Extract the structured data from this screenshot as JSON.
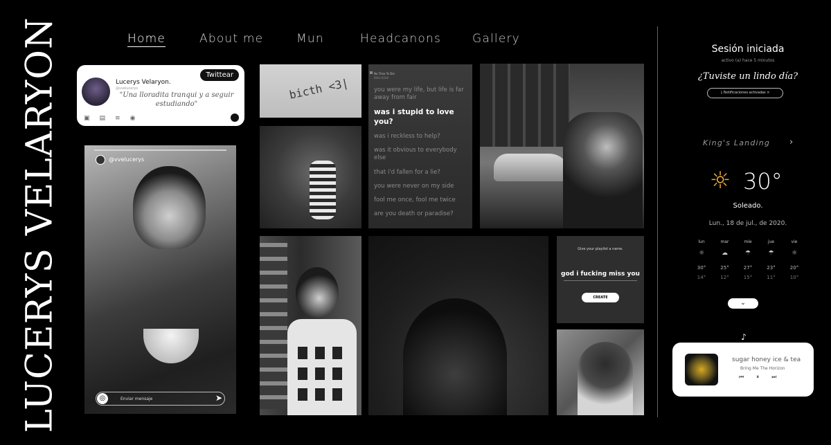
{
  "title": "LUCERYS VELARYON",
  "nav": [
    {
      "label": "Home",
      "active": true
    },
    {
      "label": "About me",
      "active": false
    },
    {
      "label": "Mun",
      "active": false
    },
    {
      "label": "Headcanons",
      "active": false
    },
    {
      "label": "Gallery",
      "active": false
    }
  ],
  "tweet": {
    "name": "Lucerys Velaryon.",
    "handle": "@vvelucerys",
    "text": "\"Una lloradita tranqui y a seguir estudiando\"",
    "button": "Twittear"
  },
  "story": {
    "user": "@vvelucerys",
    "placeholder": "Enviar mensaje"
  },
  "photo_text": "bicth <3|",
  "lyrics": {
    "song": "No Time To Die",
    "artist": "Billie Eilish",
    "lines": [
      {
        "text": "you were my life, but life is far away from fair",
        "highlight": false
      },
      {
        "text": "was i stupid to love you?",
        "highlight": true
      },
      {
        "text": "was i reckless to help?",
        "highlight": false
      },
      {
        "text": "was it obvious to everybody else",
        "highlight": false
      },
      {
        "text": "that i'd fallen for a lie?",
        "highlight": false
      },
      {
        "text": "you were never on my side",
        "highlight": false
      },
      {
        "text": "fool me once, fool me twice",
        "highlight": false
      },
      {
        "text": "are you death or paradise?",
        "highlight": false
      }
    ]
  },
  "playlist": {
    "prompt": "Give your playlist a name.",
    "name": "god i fucking miss you",
    "button": "CREATE"
  },
  "session": {
    "title": "Sesión iniciada",
    "active": "activo (a) hace 5 minutos",
    "question": "¿Tuviste un lindo día?",
    "notif": "Notificaciones activadas"
  },
  "weather": {
    "city": "King's Landing",
    "temp": "30°",
    "condition": "Soleado.",
    "date": "Lun., 18 de jul., de 2020.",
    "forecast": [
      {
        "day": "lun",
        "icon": "☼",
        "hi": "30°",
        "lo": "14°"
      },
      {
        "day": "mar",
        "icon": "☁",
        "hi": "25°",
        "lo": "12°"
      },
      {
        "day": "mie",
        "icon": "☂",
        "hi": "27°",
        "lo": "15°"
      },
      {
        "day": "jue",
        "icon": "☂",
        "hi": "23°",
        "lo": "11°"
      },
      {
        "day": "vie",
        "icon": "☼",
        "hi": "20°",
        "lo": "10°"
      }
    ]
  },
  "music": {
    "song": "sugar honey ice & tea",
    "artist": "Bring Me The Horizon"
  },
  "colors": {
    "background": "#000000",
    "accent": "#e9a93a"
  }
}
